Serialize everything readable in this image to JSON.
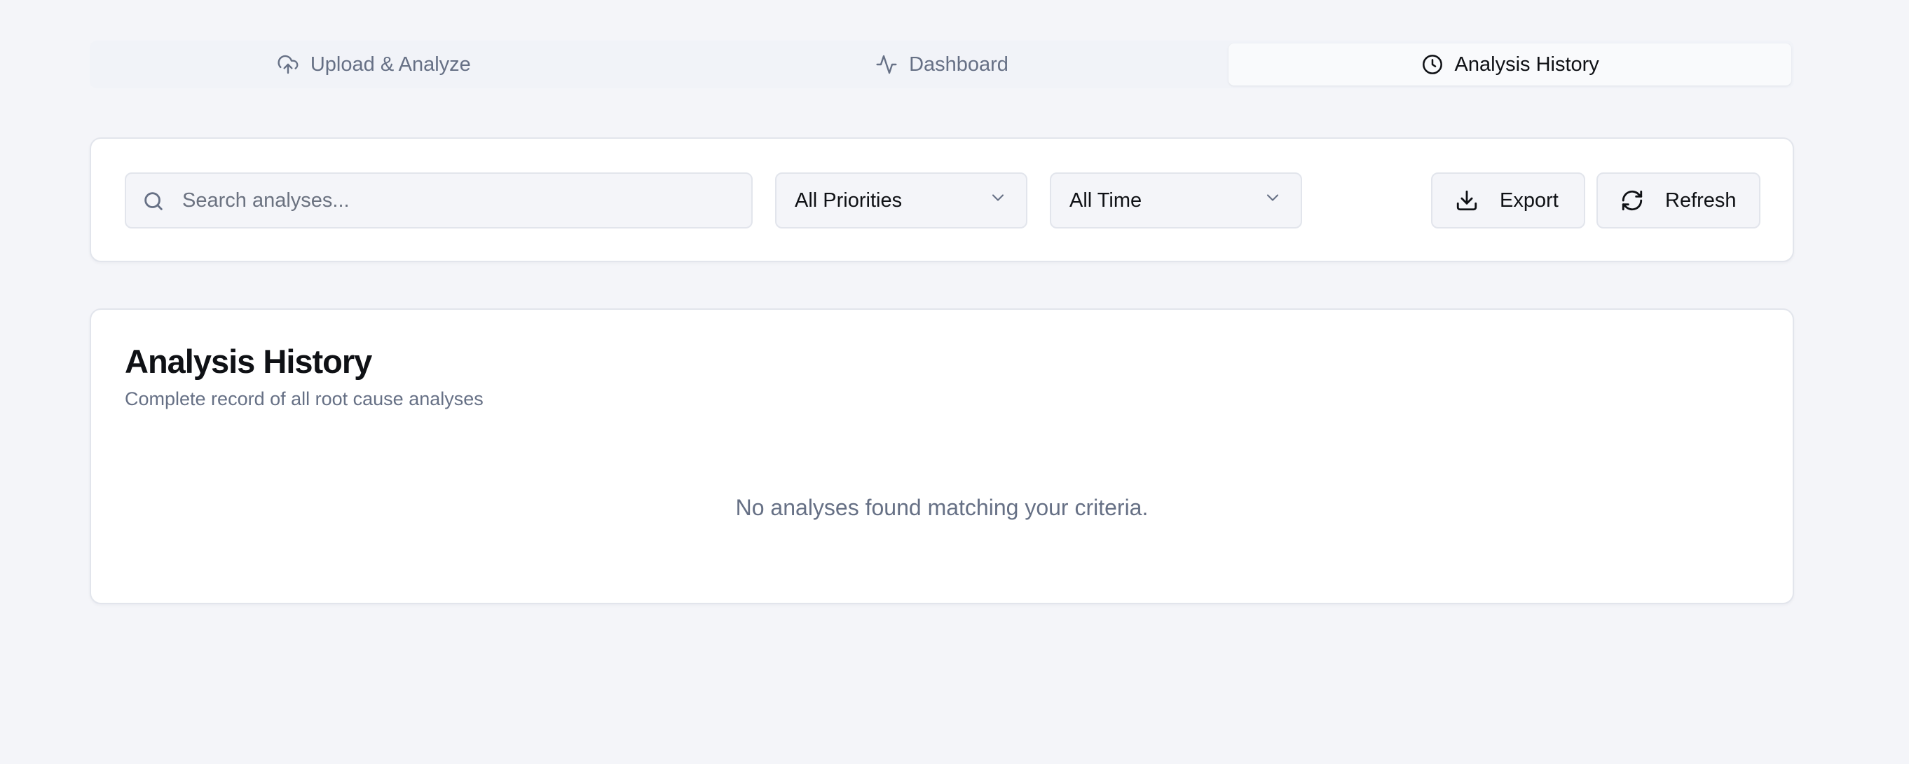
{
  "tabs": [
    {
      "label": "Upload & Analyze",
      "icon": "cloud-upload-icon",
      "active": false
    },
    {
      "label": "Dashboard",
      "icon": "activity-icon",
      "active": false
    },
    {
      "label": "Analysis History",
      "icon": "clock-icon",
      "active": true
    }
  ],
  "filters": {
    "search": {
      "placeholder": "Search analyses...",
      "value": "",
      "icon": "search-icon"
    },
    "priority": {
      "selected": "All Priorities",
      "icon": "chevron-down-icon"
    },
    "time": {
      "selected": "All Time",
      "icon": "chevron-down-icon"
    },
    "export_label": "Export",
    "export_icon": "download-icon",
    "refresh_label": "Refresh",
    "refresh_icon": "refresh-icon"
  },
  "history": {
    "title": "Analysis History",
    "subtitle": "Complete record of all root cause analyses",
    "empty_message": "No analyses found matching your criteria."
  },
  "colors": {
    "background": "#f4f5f9",
    "card": "#ffffff",
    "border": "#e2e5ec",
    "muted_text": "#667085",
    "text": "#0f1115"
  }
}
